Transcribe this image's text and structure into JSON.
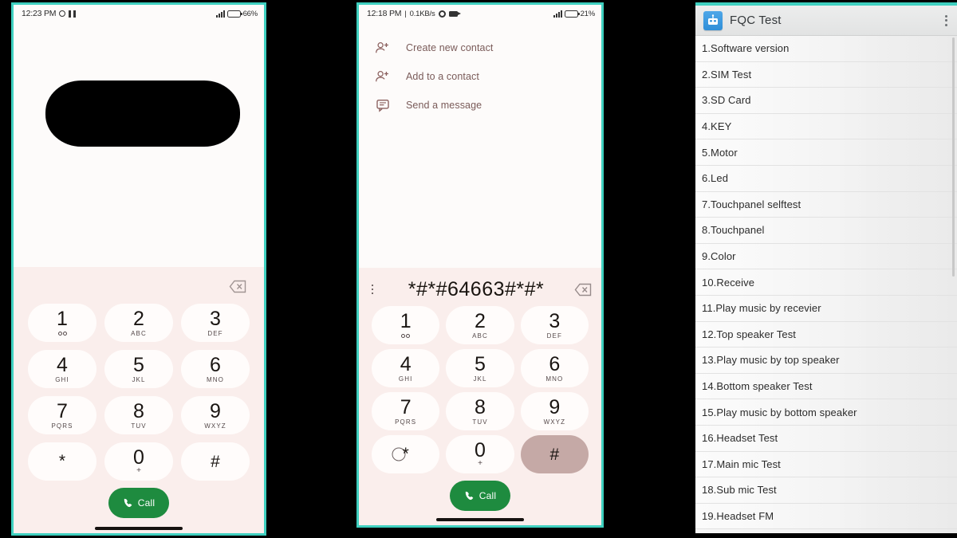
{
  "background_color": "#000000",
  "accent_frame_color": "#3fd0c0",
  "phone1": {
    "status_bar": {
      "time": "12:23 PM",
      "icons_left": [
        "circle-icon",
        "dnd-icon"
      ],
      "signal_icon": "signal-bars-icon",
      "battery_icon": "battery-icon",
      "battery_percent": "66%"
    },
    "redaction": "black-redaction-block",
    "backspace_icon": "backspace-icon",
    "keypad": [
      {
        "digit": "1",
        "letters": "",
        "sub_icon": "voicemail-icon"
      },
      {
        "digit": "2",
        "letters": "ABC",
        "sub_icon": ""
      },
      {
        "digit": "3",
        "letters": "DEF",
        "sub_icon": ""
      },
      {
        "digit": "4",
        "letters": "GHI",
        "sub_icon": ""
      },
      {
        "digit": "5",
        "letters": "JKL",
        "sub_icon": ""
      },
      {
        "digit": "6",
        "letters": "MNO",
        "sub_icon": ""
      },
      {
        "digit": "7",
        "letters": "PQRS",
        "sub_icon": ""
      },
      {
        "digit": "8",
        "letters": "TUV",
        "sub_icon": ""
      },
      {
        "digit": "9",
        "letters": "WXYZ",
        "sub_icon": ""
      },
      {
        "digit": "*",
        "letters": "",
        "sub_icon": ""
      },
      {
        "digit": "0",
        "letters": "",
        "sub_icon": "plus-icon"
      },
      {
        "digit": "#",
        "letters": "",
        "sub_icon": ""
      }
    ],
    "call_button": {
      "label": "Call",
      "icon": "phone-icon",
      "color": "#1e8b3f"
    }
  },
  "phone2": {
    "status_bar": {
      "time": "12:18 PM",
      "separator": "|",
      "data_rate": "0.1KB/s",
      "icons_left": [
        "gear-icon",
        "camera-icon"
      ],
      "signal_icon": "signal-bars-icon",
      "battery_icon": "battery-icon",
      "battery_percent": "21%"
    },
    "contact_menu": [
      {
        "label": "Create new contact",
        "icon": "person-add-icon"
      },
      {
        "label": "Add to a contact",
        "icon": "person-add-icon"
      },
      {
        "label": "Send a message",
        "icon": "message-icon"
      }
    ],
    "dialed_number": "*#*#64663#*#*",
    "overflow_icon": "kebab-menu-icon",
    "backspace_icon": "backspace-icon",
    "keypad": [
      {
        "digit": "1",
        "letters": "",
        "sub_icon": "voicemail-icon"
      },
      {
        "digit": "2",
        "letters": "ABC",
        "sub_icon": ""
      },
      {
        "digit": "3",
        "letters": "DEF",
        "sub_icon": ""
      },
      {
        "digit": "4",
        "letters": "GHI",
        "sub_icon": ""
      },
      {
        "digit": "5",
        "letters": "JKL",
        "sub_icon": ""
      },
      {
        "digit": "6",
        "letters": "MNO",
        "sub_icon": ""
      },
      {
        "digit": "7",
        "letters": "PQRS",
        "sub_icon": ""
      },
      {
        "digit": "8",
        "letters": "TUV",
        "sub_icon": ""
      },
      {
        "digit": "9",
        "letters": "WXYZ",
        "sub_icon": ""
      },
      {
        "digit": "*",
        "letters": "",
        "sub_icon": "",
        "state": "ripple"
      },
      {
        "digit": "0",
        "letters": "",
        "sub_icon": "plus-icon"
      },
      {
        "digit": "#",
        "letters": "",
        "sub_icon": "",
        "state": "pressed"
      }
    ],
    "call_button": {
      "label": "Call",
      "icon": "phone-icon",
      "color": "#1e8b3f"
    }
  },
  "phone3": {
    "app_bar": {
      "title": "FQC Test",
      "app_icon": "fqc-app-icon",
      "overflow_icon": "kebab-menu-icon"
    },
    "list_items": [
      "1.Software version",
      "2.SIM Test",
      "3.SD Card",
      "4.KEY",
      "5.Motor",
      "6.Led",
      "7.Touchpanel selftest",
      "8.Touchpanel",
      "9.Color",
      "10.Receive",
      "11.Play music by recevier",
      "12.Top speaker Test",
      "13.Play music by top speaker",
      "14.Bottom speaker Test",
      "15.Play music by bottom speaker",
      "16.Headset Test",
      "17.Main mic Test",
      "18.Sub mic Test",
      "19.Headset FM"
    ]
  }
}
